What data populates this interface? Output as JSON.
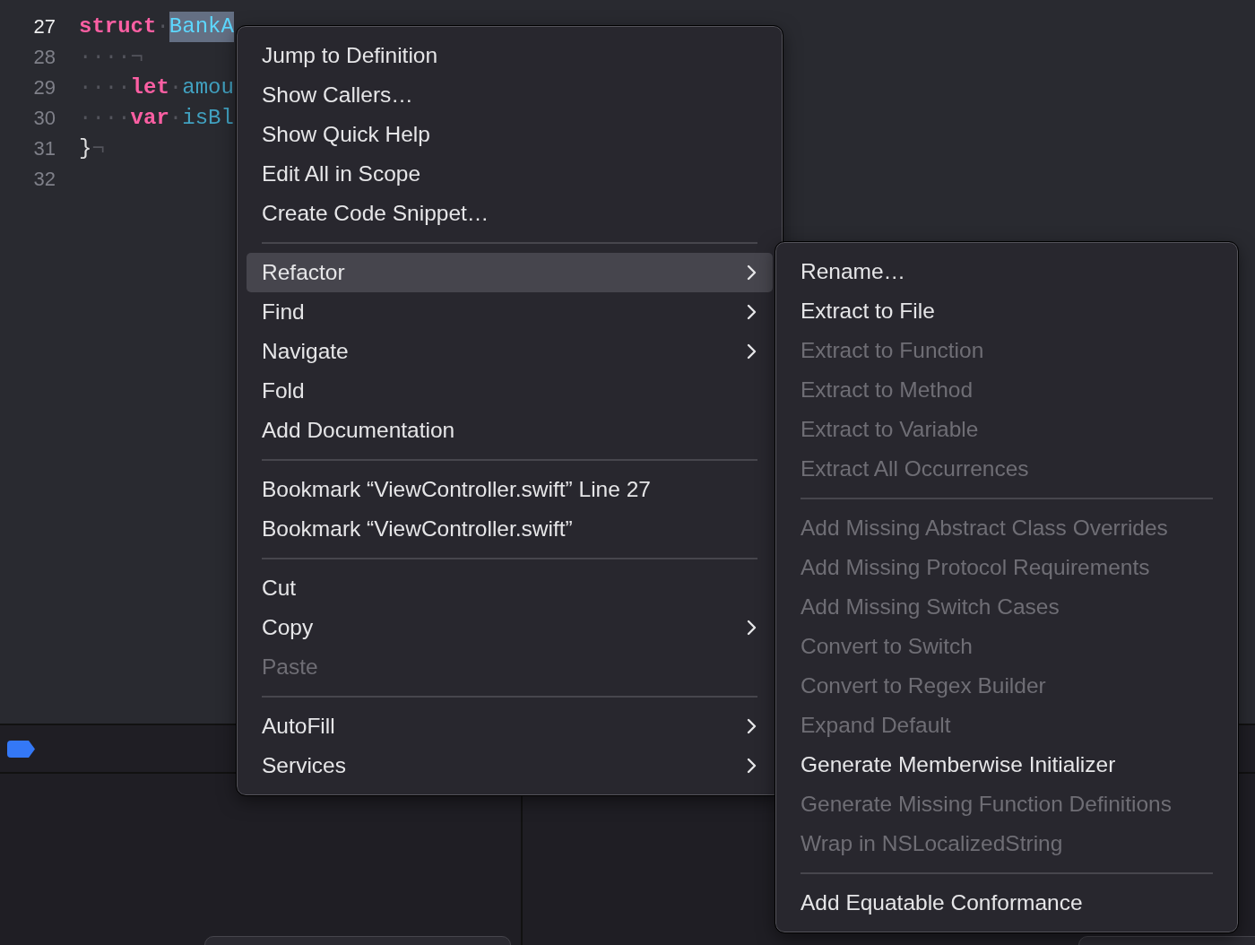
{
  "editor": {
    "lines": [
      {
        "number": "27",
        "current": true,
        "tokens": [
          {
            "kind": "keyword",
            "text": "struct"
          },
          {
            "kind": "space",
            "text": "·"
          },
          {
            "kind": "selected-type",
            "text": "BankA"
          }
        ]
      },
      {
        "number": "28",
        "current": false,
        "tokens": [
          {
            "kind": "invisible",
            "text": "····¬"
          }
        ]
      },
      {
        "number": "29",
        "current": false,
        "tokens": [
          {
            "kind": "invisible",
            "text": "····"
          },
          {
            "kind": "keyword",
            "text": "let"
          },
          {
            "kind": "space",
            "text": "·"
          },
          {
            "kind": "identifier",
            "text": "amou"
          }
        ]
      },
      {
        "number": "30",
        "current": false,
        "tokens": [
          {
            "kind": "invisible",
            "text": "····"
          },
          {
            "kind": "keyword",
            "text": "var"
          },
          {
            "kind": "space",
            "text": "·"
          },
          {
            "kind": "identifier",
            "text": "isBl"
          }
        ]
      },
      {
        "number": "31",
        "current": false,
        "tokens": [
          {
            "kind": "plain",
            "text": "}"
          },
          {
            "kind": "invisible",
            "text": "¬"
          }
        ]
      },
      {
        "number": "32",
        "current": false
      }
    ]
  },
  "context_menu": {
    "sections": [
      [
        {
          "label": "Jump to Definition",
          "selected": false,
          "disabled": false,
          "has_submenu": false
        },
        {
          "label": "Show Callers…",
          "selected": false,
          "disabled": false,
          "has_submenu": false
        },
        {
          "label": "Show Quick Help",
          "selected": false,
          "disabled": false,
          "has_submenu": false
        },
        {
          "label": "Edit All in Scope",
          "selected": false,
          "disabled": false,
          "has_submenu": false
        },
        {
          "label": "Create Code Snippet…",
          "selected": false,
          "disabled": false,
          "has_submenu": false
        }
      ],
      [
        {
          "label": "Refactor",
          "selected": true,
          "disabled": false,
          "has_submenu": true
        },
        {
          "label": "Find",
          "selected": false,
          "disabled": false,
          "has_submenu": true
        },
        {
          "label": "Navigate",
          "selected": false,
          "disabled": false,
          "has_submenu": true
        },
        {
          "label": "Fold",
          "selected": false,
          "disabled": false,
          "has_submenu": false
        },
        {
          "label": "Add Documentation",
          "selected": false,
          "disabled": false,
          "has_submenu": false
        }
      ],
      [
        {
          "label": "Bookmark “ViewController.swift” Line 27",
          "selected": false,
          "disabled": false,
          "has_submenu": false
        },
        {
          "label": "Bookmark “ViewController.swift”",
          "selected": false,
          "disabled": false,
          "has_submenu": false
        }
      ],
      [
        {
          "label": "Cut",
          "selected": false,
          "disabled": false,
          "has_submenu": false
        },
        {
          "label": "Copy",
          "selected": false,
          "disabled": false,
          "has_submenu": true
        },
        {
          "label": "Paste",
          "selected": false,
          "disabled": true,
          "has_submenu": false
        }
      ],
      [
        {
          "label": "AutoFill",
          "selected": false,
          "disabled": false,
          "has_submenu": true
        },
        {
          "label": "Services",
          "selected": false,
          "disabled": false,
          "has_submenu": true
        }
      ]
    ]
  },
  "refactor_submenu": {
    "sections": [
      [
        {
          "label": "Rename…",
          "selected": false,
          "disabled": false,
          "has_submenu": false
        },
        {
          "label": "Extract to File",
          "selected": false,
          "disabled": false,
          "has_submenu": false
        },
        {
          "label": "Extract to Function",
          "selected": false,
          "disabled": true,
          "has_submenu": false
        },
        {
          "label": "Extract to Method",
          "selected": false,
          "disabled": true,
          "has_submenu": false
        },
        {
          "label": "Extract to Variable",
          "selected": false,
          "disabled": true,
          "has_submenu": false
        },
        {
          "label": "Extract All Occurrences",
          "selected": false,
          "disabled": true,
          "has_submenu": false
        }
      ],
      [
        {
          "label": "Add Missing Abstract Class Overrides",
          "selected": false,
          "disabled": true,
          "has_submenu": false
        },
        {
          "label": "Add Missing Protocol Requirements",
          "selected": false,
          "disabled": true,
          "has_submenu": false
        },
        {
          "label": "Add Missing Switch Cases",
          "selected": false,
          "disabled": true,
          "has_submenu": false
        },
        {
          "label": "Convert to Switch",
          "selected": false,
          "disabled": true,
          "has_submenu": false
        },
        {
          "label": "Convert to Regex Builder",
          "selected": false,
          "disabled": true,
          "has_submenu": false
        },
        {
          "label": "Expand Default",
          "selected": false,
          "disabled": true,
          "has_submenu": false
        },
        {
          "label": "Generate Memberwise Initializer",
          "selected": false,
          "disabled": false,
          "has_submenu": false
        },
        {
          "label": "Generate Missing Function Definitions",
          "selected": false,
          "disabled": true,
          "has_submenu": false
        },
        {
          "label": "Wrap in NSLocalizedString",
          "selected": false,
          "disabled": true,
          "has_submenu": false
        }
      ],
      [
        {
          "label": "Add Equatable Conformance",
          "selected": false,
          "disabled": false,
          "has_submenu": false
        }
      ]
    ]
  }
}
